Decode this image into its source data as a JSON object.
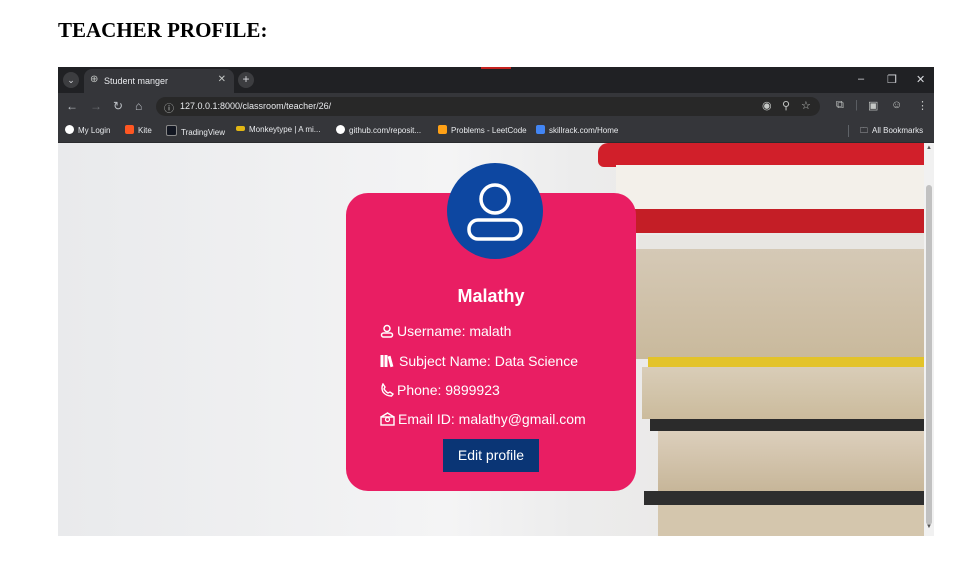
{
  "heading": "TEACHER PROFILE:",
  "browser": {
    "tab_title": "Student manger",
    "url": "127.0.0.1:8000/classroom/teacher/26/",
    "bookmarks": [
      {
        "label": "My Login",
        "color": "#ffffff"
      },
      {
        "label": "Kite",
        "color": "#ff5722"
      },
      {
        "label": "TradingView",
        "color": "#131722"
      },
      {
        "label": "Monkeytype | A mi...",
        "color": "#e2b714"
      },
      {
        "label": "github.com/reposit...",
        "color": "#ffffff"
      },
      {
        "label": "Problems - LeetCode",
        "color": "#ffa116"
      },
      {
        "label": "skillrack.com/Home",
        "color": "#4285f4"
      }
    ],
    "all_bookmarks": "All Bookmarks"
  },
  "profile": {
    "name": "Malathy",
    "username_label": "Username: malath",
    "subject_label": "Subject Name: Data Science",
    "phone_label": "Phone: 9899923",
    "email_label": "Email ID: malathy@gmail.com",
    "edit_button": "Edit profile"
  },
  "colors": {
    "card": "#e91e63",
    "avatar": "#0d47a1",
    "button": "#0a3575"
  }
}
